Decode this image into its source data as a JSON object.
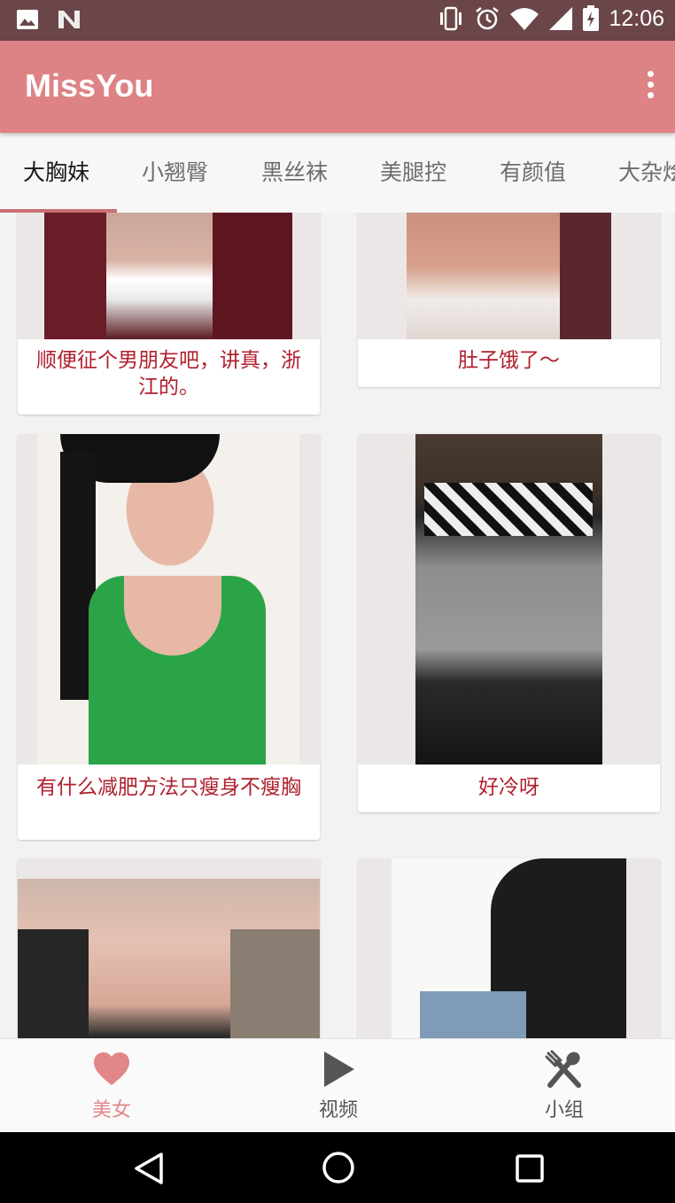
{
  "status_bar": {
    "time": "12:06",
    "left_icons": [
      "image-icon",
      "n-icon"
    ],
    "right_icons": [
      "vibrate-icon",
      "alarm-icon",
      "wifi-icon",
      "signal-icon",
      "battery-icon"
    ]
  },
  "app_bar": {
    "title": "MissYou",
    "menu_icon": "more-vert-icon"
  },
  "tabs": [
    {
      "label": "大胸妹",
      "active": true
    },
    {
      "label": "小翘臀",
      "active": false
    },
    {
      "label": "黑丝袜",
      "active": false
    },
    {
      "label": "美腿控",
      "active": false
    },
    {
      "label": "有颜值",
      "active": false
    },
    {
      "label": "大杂烩",
      "active": false
    }
  ],
  "cards": [
    {
      "caption": "顺便征个男朋友吧，讲真，浙江的。"
    },
    {
      "caption": "肚子饿了～"
    },
    {
      "caption": "有什么减肥方法只瘦身不瘦胸"
    },
    {
      "caption": "好冷呀"
    },
    {
      "caption": ""
    },
    {
      "caption": ""
    }
  ],
  "bottom_nav": [
    {
      "label": "美女",
      "icon": "heart-icon",
      "active": true
    },
    {
      "label": "视频",
      "icon": "play-icon",
      "active": false
    },
    {
      "label": "小组",
      "icon": "fork-knife-icon",
      "active": false
    }
  ],
  "colors": {
    "status_bar": "#6b4649",
    "app_bar": "#dd8285",
    "accent": "#e28789",
    "caption_text": "#b0202e"
  }
}
